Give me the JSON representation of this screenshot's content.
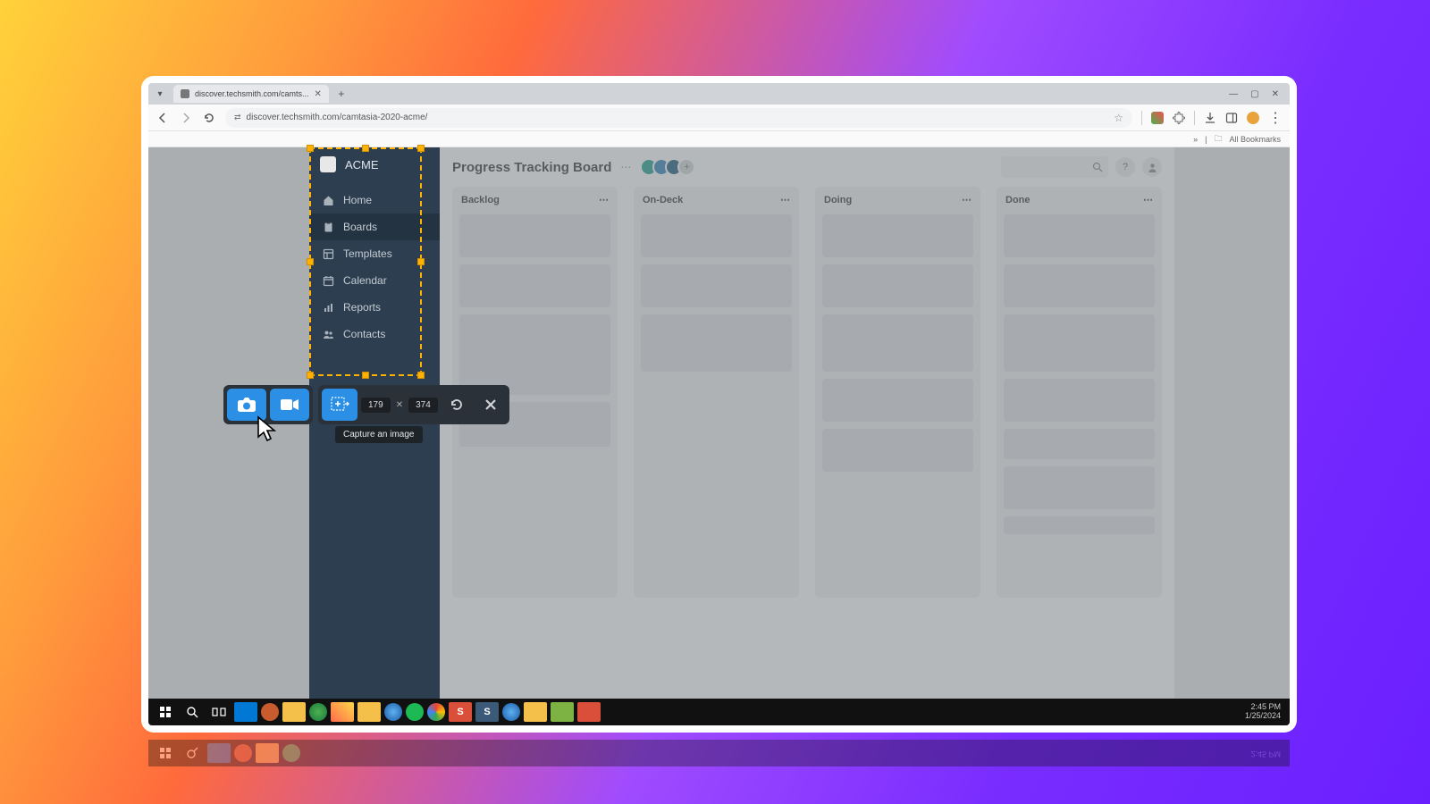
{
  "browser": {
    "tab_title": "discover.techsmith.com/camts...",
    "url": "discover.techsmith.com/camtasia-2020-acme/",
    "bookmarks_label": "All Bookmarks"
  },
  "sidebar": {
    "brand": "ACME",
    "items": [
      {
        "label": "Home",
        "icon": "home"
      },
      {
        "label": "Boards",
        "icon": "clipboard"
      },
      {
        "label": "Templates",
        "icon": "template"
      },
      {
        "label": "Calendar",
        "icon": "calendar"
      },
      {
        "label": "Reports",
        "icon": "report"
      },
      {
        "label": "Contacts",
        "icon": "contacts"
      }
    ]
  },
  "board": {
    "title": "Progress Tracking Board",
    "columns": [
      {
        "name": "Backlog"
      },
      {
        "name": "On-Deck"
      },
      {
        "name": "Doing"
      },
      {
        "name": "Done"
      }
    ]
  },
  "capture": {
    "width": "179",
    "height": "374",
    "tooltip": "Capture an image"
  },
  "taskbar": {
    "time": "2:45 PM",
    "date": "1/25/2024"
  }
}
